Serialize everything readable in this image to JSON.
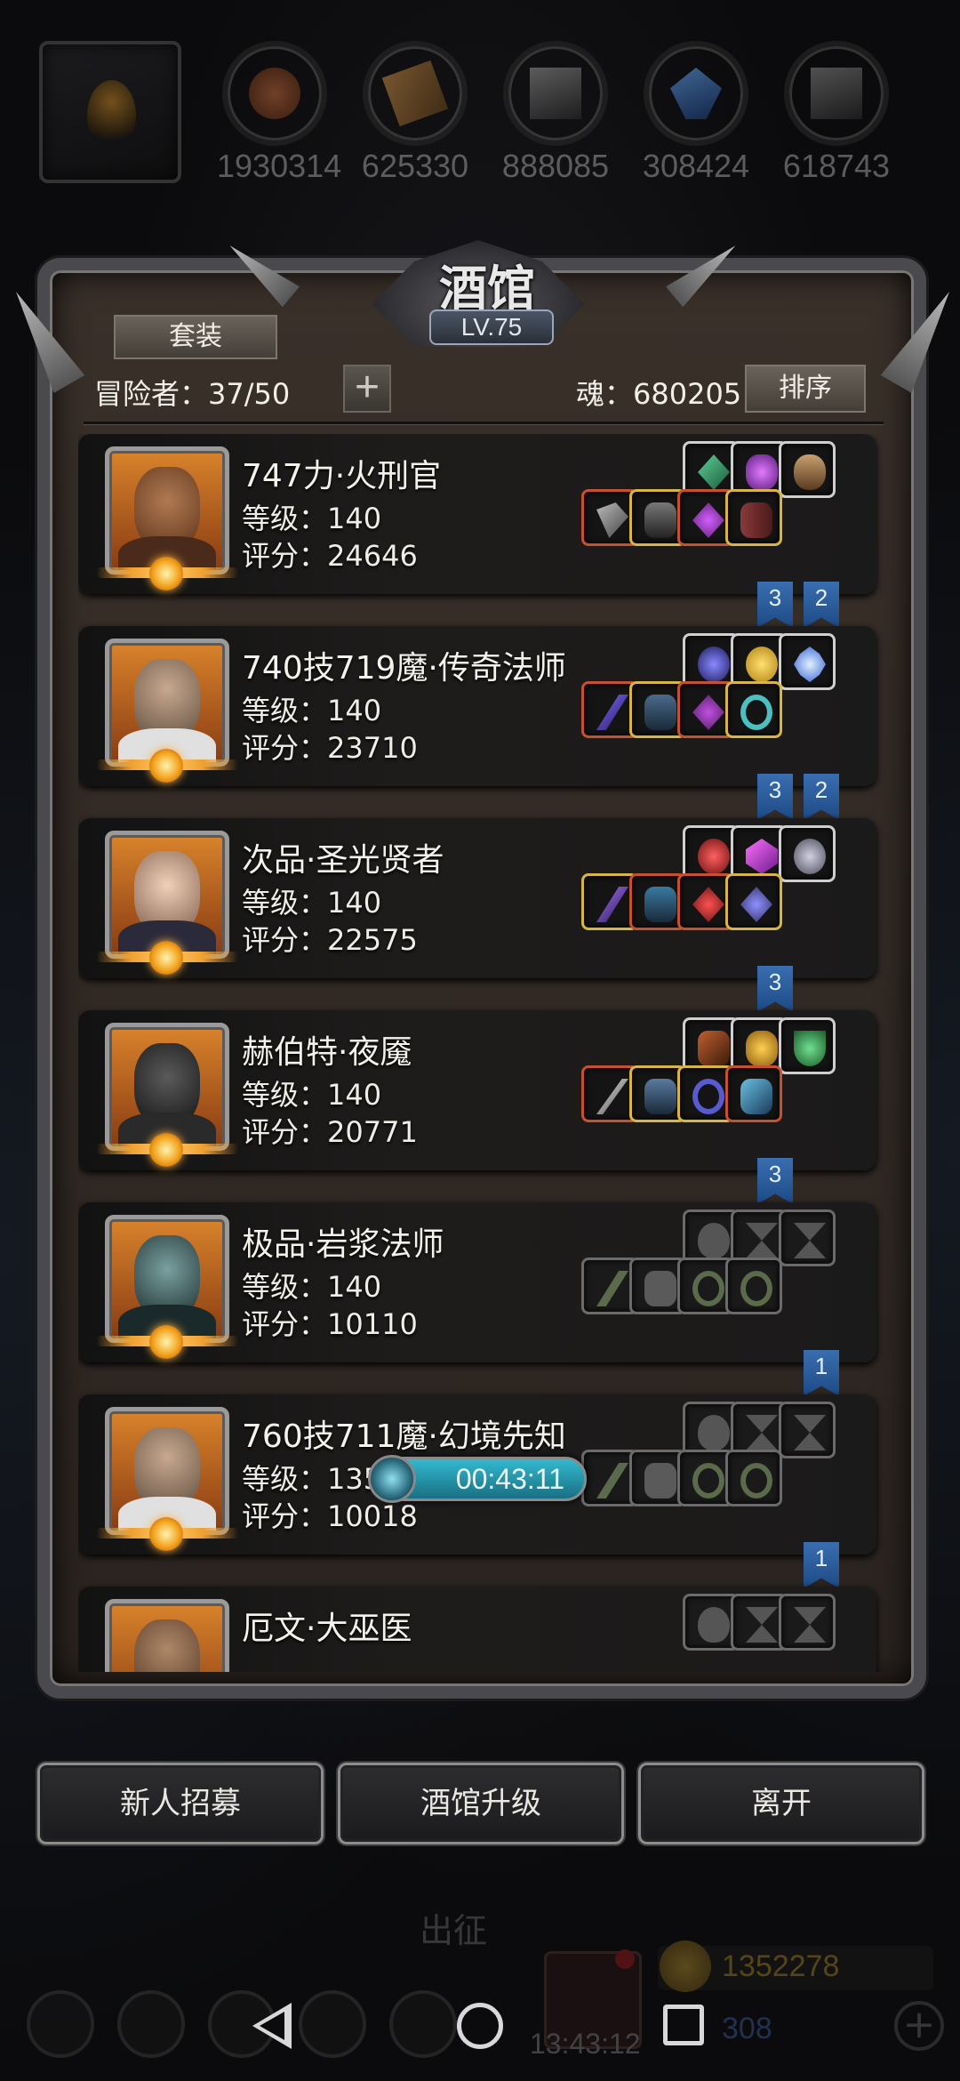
{
  "resources": [
    {
      "name": "meat",
      "value": "1930314",
      "color": "#a0522d"
    },
    {
      "name": "wood",
      "value": "625330",
      "color": "#b5823a"
    },
    {
      "name": "iron",
      "value": "888085",
      "color": "#6a6a6a"
    },
    {
      "name": "crystal",
      "value": "308424",
      "color": "#3d7fc9"
    },
    {
      "name": "stone",
      "value": "618743",
      "color": "#777777"
    }
  ],
  "panel": {
    "title": "酒馆",
    "level": "LV.75",
    "suit_tab": "套装",
    "adventurers": "冒险者：37/50",
    "soul": "魂：680205",
    "sort": "排序"
  },
  "heroes": [
    {
      "name": "747力·火刑官",
      "level": "等级：140",
      "score": "评分：24646",
      "ribbons": [
        "3",
        "2"
      ],
      "skin": "#7a4a2a"
    },
    {
      "name": "740技719魔·传奇法师",
      "level": "等级：140",
      "score": "评分：23710",
      "ribbons": [
        "3",
        "2"
      ],
      "skin": "#9a8a7a"
    },
    {
      "name": "次品·圣光贤者",
      "level": "等级：140",
      "score": "评分：22575",
      "ribbons": [
        "3"
      ],
      "skin": "#e0c0a8"
    },
    {
      "name": "赫伯特·夜魇",
      "level": "等级：140",
      "score": "评分：20771",
      "ribbons": [
        "3"
      ],
      "skin": "#3a3a3a"
    },
    {
      "name": "极品·岩浆法师",
      "level": "等级：140",
      "score": "评分：10110",
      "ribbons": [
        "1"
      ],
      "skin": "#4a6a6a"
    },
    {
      "name": "760技711魔·幻境先知",
      "level": "等级：135",
      "score": "评分：10018",
      "ribbons": [
        "1"
      ],
      "skin": "#a08a78"
    },
    {
      "name": "厄文·大巫医",
      "level": "",
      "score": "",
      "ribbons": [],
      "skin": "#8a6a4a"
    }
  ],
  "timer": "00:43:11",
  "buttons": {
    "recruit": "新人招募",
    "upgrade": "酒馆升级",
    "leave": "离开"
  },
  "bottom": {
    "expedition": "出征",
    "gold": "1352278",
    "gems": "308",
    "clock": "13:43:12"
  }
}
